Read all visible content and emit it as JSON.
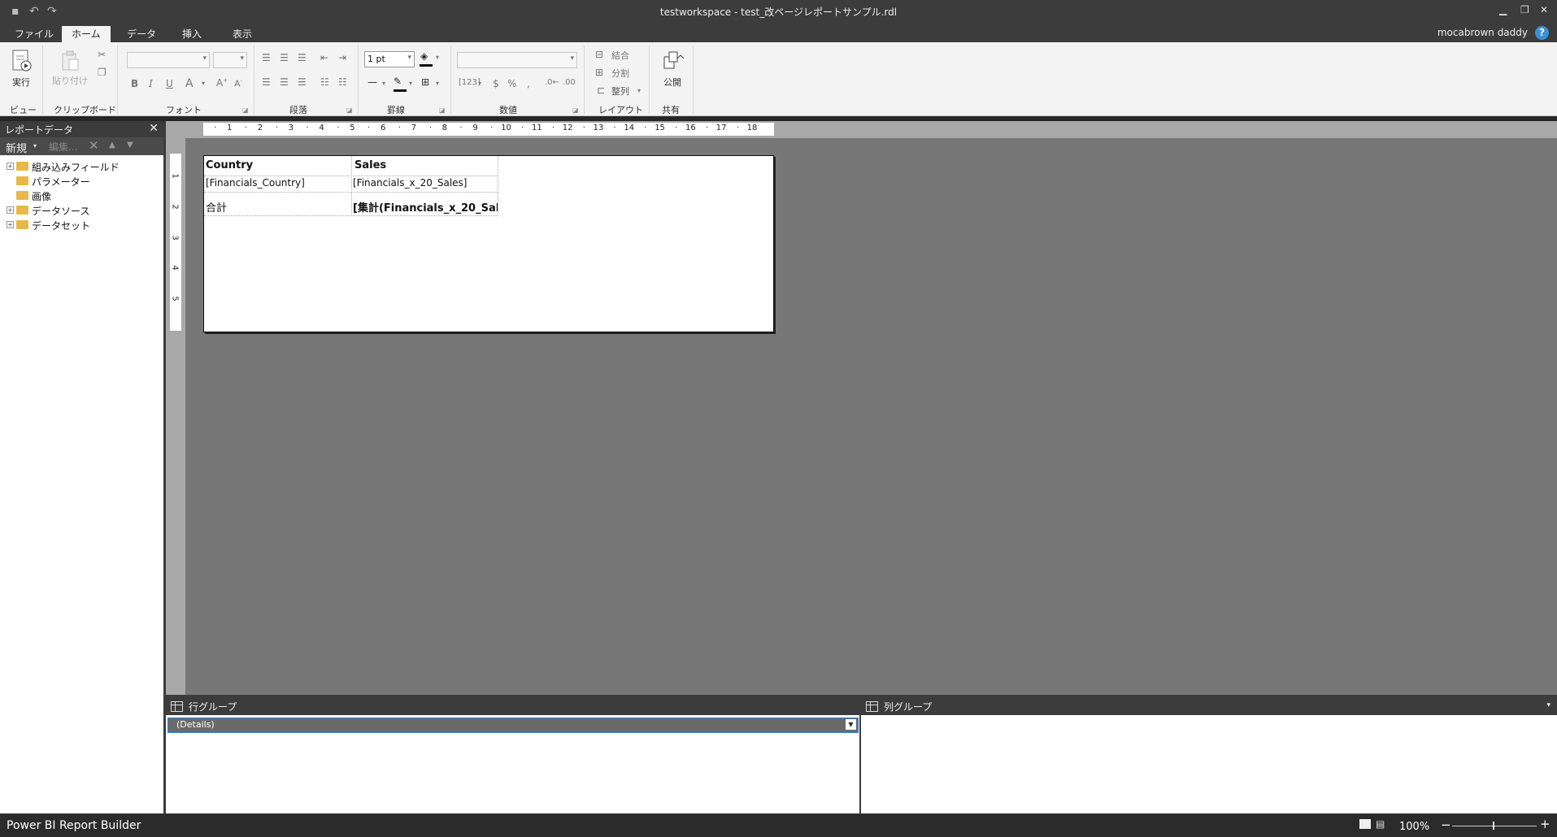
{
  "window": {
    "title": "testworkspace - test_改ページレポートサンプル.rdl",
    "user": "mocabrown daddy"
  },
  "tabs": [
    "ファイル",
    "ホーム",
    "データ",
    "挿入",
    "表示"
  ],
  "ribbon": {
    "run_label": "実行",
    "paste_label": "貼り付け",
    "groups": {
      "view": "ビュー",
      "clipboard": "クリップボード",
      "font": "フォント",
      "paragraph": "段落",
      "border": "罫線",
      "number": "数値",
      "layout": "レイアウト",
      "share": "共有"
    },
    "border_width": "1 pt",
    "merge_label": "結合",
    "split_label": "分割",
    "align_label": "整列",
    "publish_label": "公開"
  },
  "left_panel": {
    "title": "レポートデータ",
    "new_label": "新規",
    "edit_label": "編集...",
    "tree": [
      {
        "label": "組み込みフィールド",
        "expandable": true
      },
      {
        "label": "パラメーター",
        "expandable": false
      },
      {
        "label": "画像",
        "expandable": false
      },
      {
        "label": "データソース",
        "expandable": true
      },
      {
        "label": "データセット",
        "expandable": true
      }
    ]
  },
  "ruler": {
    "h_ticks": [
      "1",
      "2",
      "3",
      "4",
      "5",
      "6",
      "7",
      "8",
      "9",
      "10",
      "11",
      "12",
      "13",
      "14",
      "15",
      "16",
      "17",
      "18"
    ],
    "v_ticks": [
      "1",
      "2",
      "3",
      "4",
      "5"
    ]
  },
  "report_table": {
    "headers": [
      "Country",
      "Sales"
    ],
    "detail": [
      "[Financials_Country]",
      "[Financials_x_20_Sales]"
    ],
    "total": [
      "合計",
      "[集計(Financials_x_20_Sale"
    ]
  },
  "row_groups": {
    "title": "行グループ",
    "items": [
      "(Details)"
    ]
  },
  "col_groups": {
    "title": "列グループ"
  },
  "status": {
    "app_name": "Power BI Report Builder",
    "zoom": "100%"
  }
}
